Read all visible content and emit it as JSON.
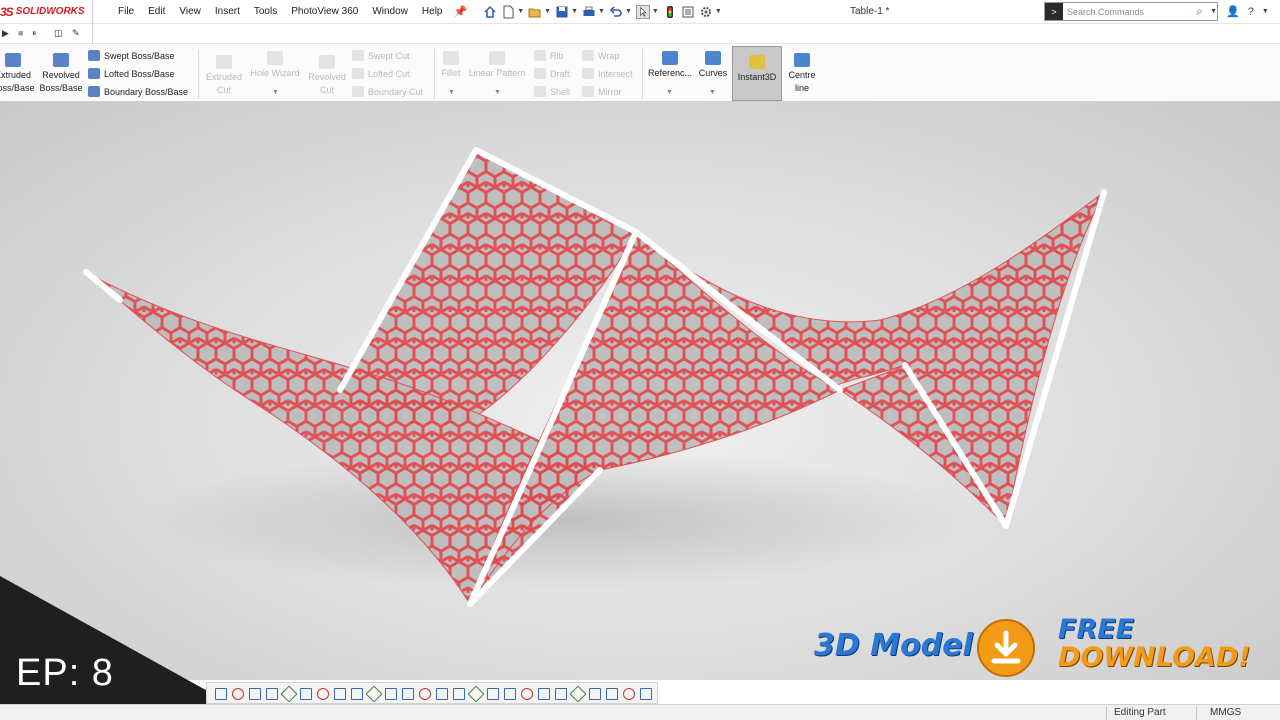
{
  "app": {
    "logo_prefix": "3S",
    "logo_name": "SOLIDWORKS"
  },
  "menu": [
    "File",
    "Edit",
    "View",
    "Insert",
    "Tools",
    "PhotoView 360",
    "Window",
    "Help"
  ],
  "document": {
    "title": "Table-1 *"
  },
  "search": {
    "placeholder": "Search Commands"
  },
  "ribbon": {
    "extruded_boss": "Extruded Boss/Base",
    "revolved_boss": "Revolved Boss/Base",
    "swept_boss": "Swept Boss/Base",
    "lofted_boss": "Lofted Boss/Base",
    "boundary_boss": "Boundary Boss/Base",
    "extruded_cut": "Extruded Cut",
    "hole_wizard": "Hole Wizard",
    "revolved_cut": "Revolved Cut",
    "swept_cut": "Swept Cut",
    "lofted_cut": "Lofted Cut",
    "boundary_cut": "Boundary Cut",
    "fillet": "Fillet",
    "linear_pattern": "Linear Pattern",
    "rib": "Rib",
    "draft": "Draft",
    "shell": "Shell",
    "wrap": "Wrap",
    "intersect": "Intersect",
    "mirror": "Mirror",
    "reference": "Referenc...",
    "curves": "Curves",
    "instant3d": "Instant3D",
    "centreline": "Centre line"
  },
  "overlay": {
    "episode": "EP: 8",
    "model": "3D Model",
    "free": "FREE",
    "download": "DOWNLOAD!"
  },
  "status": {
    "mode": "Editing Part",
    "units": "MMGS"
  },
  "colors": {
    "mesh": "#e14a4f",
    "frame": "#ffffff",
    "accent_orange": "#f39a16",
    "accent_blue": "#2a78d4"
  }
}
